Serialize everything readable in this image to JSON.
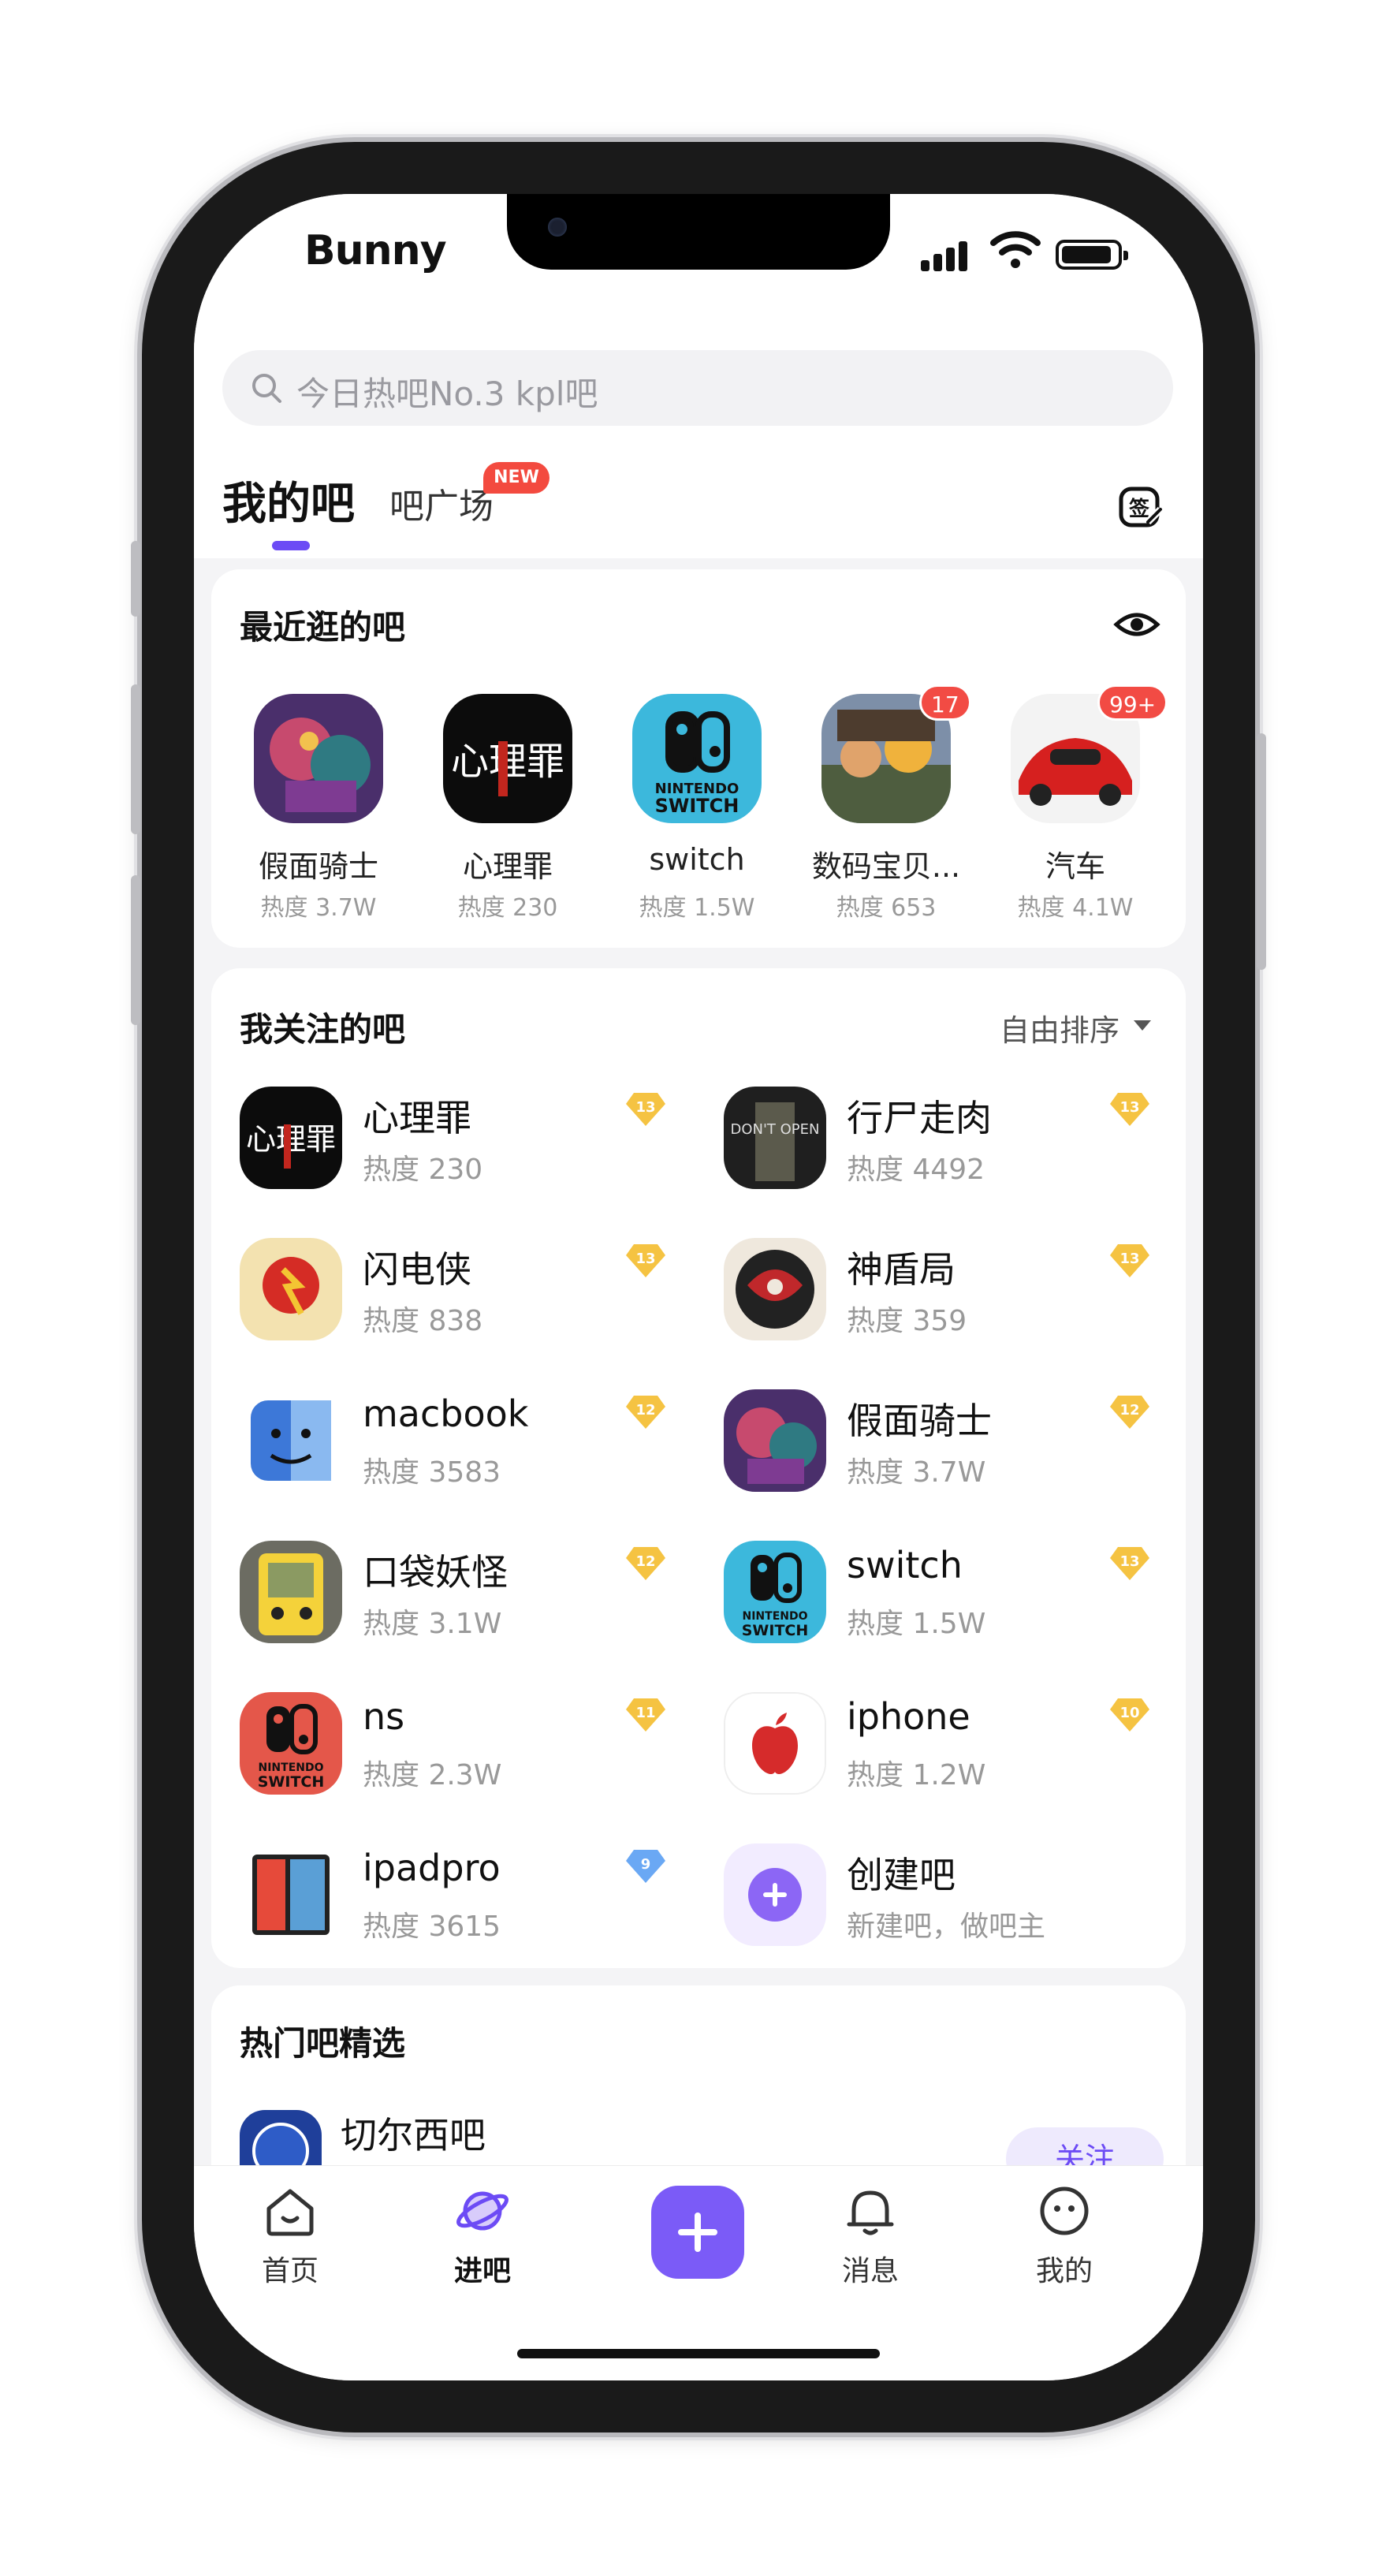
{
  "status_bar": {
    "carrier": "Bunny"
  },
  "search": {
    "placeholder": "今日热吧No.3 kpl吧"
  },
  "tabs": {
    "mine": "我的吧",
    "square": "吧广场",
    "new_badge": "NEW"
  },
  "recent": {
    "title": "最近逛的吧",
    "items": [
      {
        "name": "假面骑士",
        "heat": "热度 3.7W",
        "badge": ""
      },
      {
        "name": "心理罪",
        "heat": "热度 230",
        "badge": ""
      },
      {
        "name": "switch",
        "heat": "热度 1.5W",
        "badge": ""
      },
      {
        "name": "数码宝贝...",
        "heat": "热度 653",
        "badge": "17"
      },
      {
        "name": "汽车",
        "heat": "热度 4.1W",
        "badge": "99+"
      }
    ]
  },
  "followed": {
    "title": "我关注的吧",
    "sort_label": "自由排序",
    "items": [
      {
        "name": "心理罪",
        "heat": "热度 230",
        "level": "13"
      },
      {
        "name": "行尸走肉",
        "heat": "热度 4492",
        "level": "13"
      },
      {
        "name": "闪电侠",
        "heat": "热度 838",
        "level": "13"
      },
      {
        "name": "神盾局",
        "heat": "热度 359",
        "level": "13"
      },
      {
        "name": "macbook",
        "heat": "热度 3583",
        "level": "12"
      },
      {
        "name": "假面骑士",
        "heat": "热度 3.7W",
        "level": "12"
      },
      {
        "name": "口袋妖怪",
        "heat": "热度 3.1W",
        "level": "12"
      },
      {
        "name": "switch",
        "heat": "热度 1.5W",
        "level": "13"
      },
      {
        "name": "ns",
        "heat": "热度 2.3W",
        "level": "11"
      },
      {
        "name": "iphone",
        "heat": "热度 1.2W",
        "level": "10"
      },
      {
        "name": "ipadpro",
        "heat": "热度 3615",
        "level": "9"
      },
      {
        "name": "创建吧",
        "heat": "新建吧，做吧主",
        "level": ""
      }
    ]
  },
  "hot": {
    "title": "热门吧精选",
    "first_item": "切尔西吧",
    "follow_label": "关注"
  },
  "nav": {
    "home": "首页",
    "bar": "进吧",
    "messages": "消息",
    "me": "我的"
  },
  "colors": {
    "accent": "#6c4bf5",
    "badge_red": "#f24b44",
    "level_gold": "#f5c342",
    "level_blue": "#6aa8f4"
  },
  "icons": [
    "search-icon",
    "sign-in-icon",
    "eye-icon",
    "caret-down-icon",
    "level-badge-icon",
    "home-icon",
    "planet-icon",
    "plus-icon",
    "bell-icon",
    "smile-icon"
  ]
}
